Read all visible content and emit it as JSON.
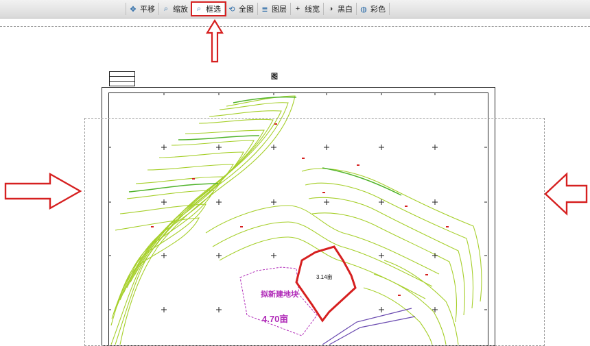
{
  "toolbar": {
    "buttons": [
      {
        "label": "平移",
        "icon": "pan-icon"
      },
      {
        "label": "缩放",
        "icon": "zoom-icon"
      },
      {
        "label": "框选",
        "icon": "box-select-icon",
        "active": true
      },
      {
        "label": "全图",
        "icon": "full-map-icon"
      },
      {
        "label": "图层",
        "icon": "layers-icon"
      },
      {
        "label": "线宽",
        "icon": "line-width-icon"
      },
      {
        "label": "黑白",
        "icon": "black-white-icon"
      },
      {
        "label": "彩色",
        "icon": "color-icon"
      }
    ]
  },
  "map": {
    "title": "图",
    "area_label_1": "3.14亩",
    "area_label_2": "拟新建地块",
    "area_label_3": "4.70亩"
  },
  "colors": {
    "highlight": "#d62020",
    "contour": "#a6cf2a",
    "label_purple": "#b02ab8"
  }
}
